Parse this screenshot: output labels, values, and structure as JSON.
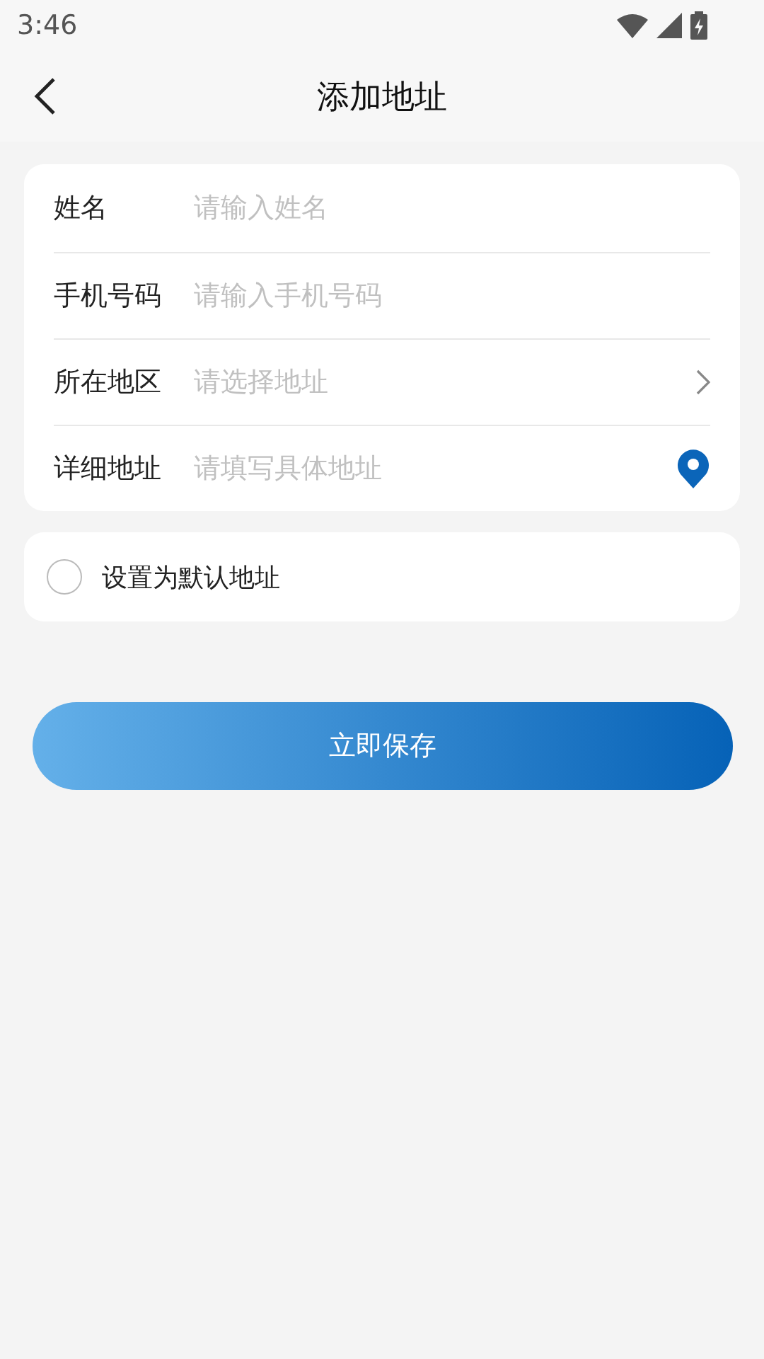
{
  "status_bar": {
    "time": "3:46"
  },
  "header": {
    "title": "添加地址"
  },
  "form": {
    "rows": [
      {
        "kind": "input",
        "label": "姓名",
        "placeholder": "请输入姓名"
      },
      {
        "kind": "input",
        "label": "手机号码",
        "placeholder": "请输入手机号码"
      },
      {
        "kind": "select",
        "label": "所在地区",
        "placeholder": "请选择地址"
      },
      {
        "kind": "location",
        "label": "详细地址",
        "placeholder": "请填写具体地址"
      }
    ]
  },
  "default_option": {
    "label": "设置为默认地址",
    "checked": false
  },
  "save_button": {
    "label": "立即保存"
  }
}
